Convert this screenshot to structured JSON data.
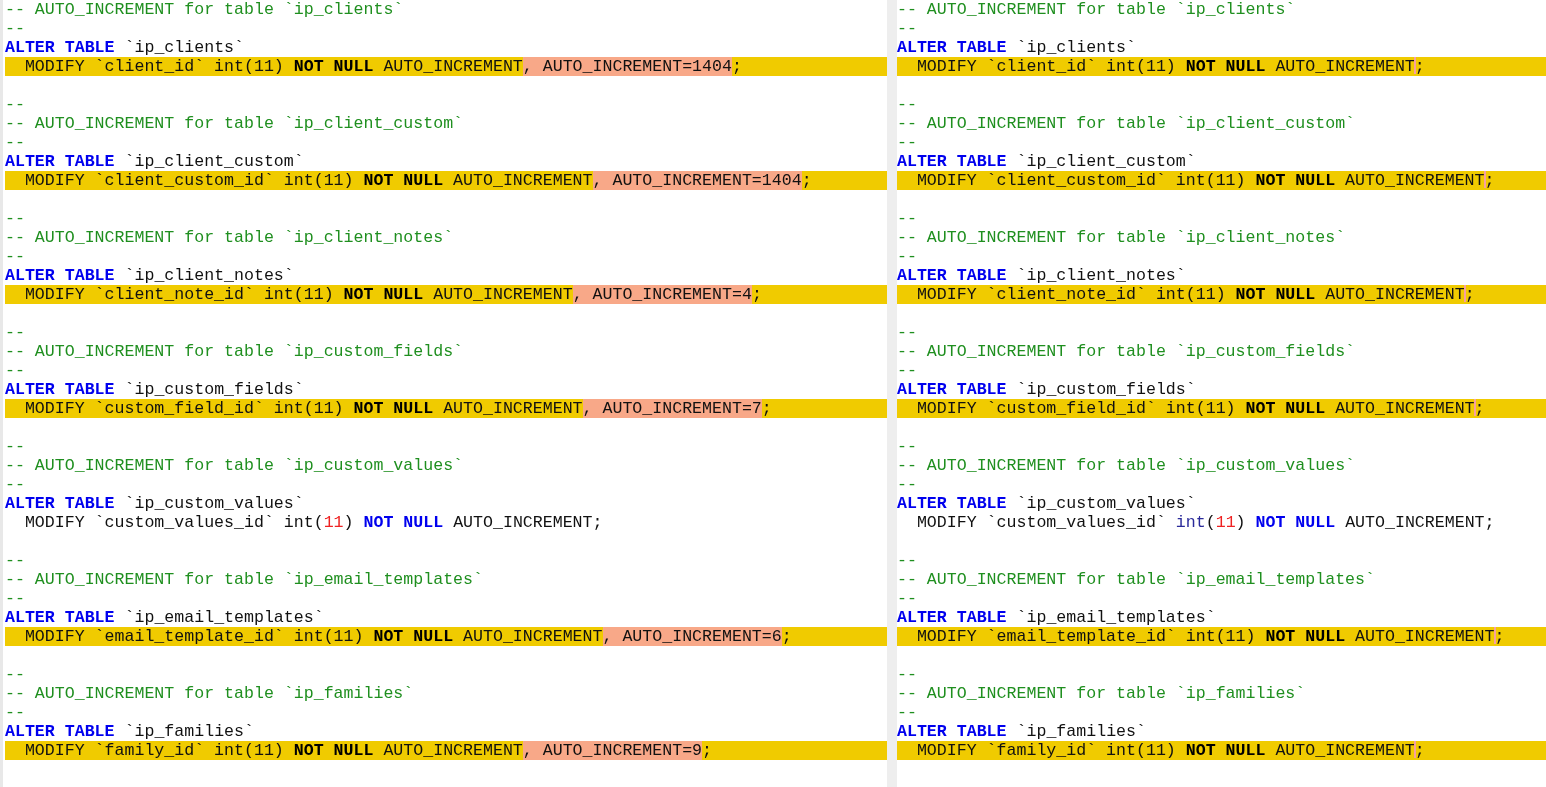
{
  "panes": [
    {
      "lines": [
        {
          "changed": false,
          "segments": [
            {
              "kind": "comment",
              "text": "-- AUTO_INCREMENT for table `ip_clients`"
            }
          ]
        },
        {
          "changed": false,
          "segments": [
            {
              "kind": "comment",
              "text": "--"
            }
          ]
        },
        {
          "changed": false,
          "segments": [
            {
              "kind": "keyword",
              "text": "ALTER TABLE"
            },
            {
              "kind": "text",
              "text": " `ip_clients`"
            }
          ]
        },
        {
          "changed": true,
          "segments": [
            {
              "kind": "text",
              "text": "  MODIFY `client_id` int(11) "
            },
            {
              "kind": "strong",
              "text": "NOT NULL"
            },
            {
              "kind": "text",
              "text": " AUTO_INCREMENT"
            },
            {
              "kind": "text",
              "text": ", AUTO_INCREMENT=1404",
              "removed": true
            },
            {
              "kind": "text",
              "text": ";"
            }
          ]
        },
        {
          "changed": false
        },
        {
          "changed": false,
          "segments": [
            {
              "kind": "comment",
              "text": "--"
            }
          ]
        },
        {
          "changed": false,
          "segments": [
            {
              "kind": "comment",
              "text": "-- AUTO_INCREMENT for table `ip_client_custom`"
            }
          ]
        },
        {
          "changed": false,
          "segments": [
            {
              "kind": "comment",
              "text": "--"
            }
          ]
        },
        {
          "changed": false,
          "segments": [
            {
              "kind": "keyword",
              "text": "ALTER TABLE"
            },
            {
              "kind": "text",
              "text": " `ip_client_custom`"
            }
          ]
        },
        {
          "changed": true,
          "segments": [
            {
              "kind": "text",
              "text": "  MODIFY `client_custom_id` int(11) "
            },
            {
              "kind": "strong",
              "text": "NOT NULL"
            },
            {
              "kind": "text",
              "text": " AUTO_INCREMENT"
            },
            {
              "kind": "text",
              "text": ", AUTO_INCREMENT=1404",
              "removed": true
            },
            {
              "kind": "text",
              "text": ";"
            }
          ]
        },
        {
          "changed": false
        },
        {
          "changed": false,
          "segments": [
            {
              "kind": "comment",
              "text": "--"
            }
          ]
        },
        {
          "changed": false,
          "segments": [
            {
              "kind": "comment",
              "text": "-- AUTO_INCREMENT for table `ip_client_notes`"
            }
          ]
        },
        {
          "changed": false,
          "segments": [
            {
              "kind": "comment",
              "text": "--"
            }
          ]
        },
        {
          "changed": false,
          "segments": [
            {
              "kind": "keyword",
              "text": "ALTER TABLE"
            },
            {
              "kind": "text",
              "text": " `ip_client_notes`"
            }
          ]
        },
        {
          "changed": true,
          "segments": [
            {
              "kind": "text",
              "text": "  MODIFY `client_note_id` int(11) "
            },
            {
              "kind": "strong",
              "text": "NOT NULL"
            },
            {
              "kind": "text",
              "text": " AUTO_INCREMENT"
            },
            {
              "kind": "text",
              "text": ", AUTO_INCREMENT=4",
              "removed": true
            },
            {
              "kind": "text",
              "text": ";"
            }
          ]
        },
        {
          "changed": false
        },
        {
          "changed": false,
          "segments": [
            {
              "kind": "comment",
              "text": "--"
            }
          ]
        },
        {
          "changed": false,
          "segments": [
            {
              "kind": "comment",
              "text": "-- AUTO_INCREMENT for table `ip_custom_fields`"
            }
          ]
        },
        {
          "changed": false,
          "segments": [
            {
              "kind": "comment",
              "text": "--"
            }
          ]
        },
        {
          "changed": false,
          "segments": [
            {
              "kind": "keyword",
              "text": "ALTER TABLE"
            },
            {
              "kind": "text",
              "text": " `ip_custom_fields`"
            }
          ]
        },
        {
          "changed": true,
          "segments": [
            {
              "kind": "text",
              "text": "  MODIFY `custom_field_id` int(11) "
            },
            {
              "kind": "strong",
              "text": "NOT NULL"
            },
            {
              "kind": "text",
              "text": " AUTO_INCREMENT"
            },
            {
              "kind": "text",
              "text": ", AUTO_INCREMENT=7",
              "removed": true
            },
            {
              "kind": "text",
              "text": ";"
            }
          ]
        },
        {
          "changed": false
        },
        {
          "changed": false,
          "segments": [
            {
              "kind": "comment",
              "text": "--"
            }
          ]
        },
        {
          "changed": false,
          "segments": [
            {
              "kind": "comment",
              "text": "-- AUTO_INCREMENT for table `ip_custom_values`"
            }
          ]
        },
        {
          "changed": false,
          "segments": [
            {
              "kind": "comment",
              "text": "--"
            }
          ]
        },
        {
          "changed": false,
          "segments": [
            {
              "kind": "keyword",
              "text": "ALTER TABLE"
            },
            {
              "kind": "text",
              "text": " `ip_custom_values`"
            }
          ]
        },
        {
          "changed": false,
          "segments": [
            {
              "kind": "text",
              "text": "  MODIFY `custom_values_id` int("
            },
            {
              "kind": "number",
              "text": "11"
            },
            {
              "kind": "text",
              "text": ") "
            },
            {
              "kind": "keyword",
              "text": "NOT NULL"
            },
            {
              "kind": "text",
              "text": " AUTO_INCREMENT;"
            }
          ]
        },
        {
          "changed": false
        },
        {
          "changed": false,
          "segments": [
            {
              "kind": "comment",
              "text": "--"
            }
          ]
        },
        {
          "changed": false,
          "segments": [
            {
              "kind": "comment",
              "text": "-- AUTO_INCREMENT for table `ip_email_templates`"
            }
          ]
        },
        {
          "changed": false,
          "segments": [
            {
              "kind": "comment",
              "text": "--"
            }
          ]
        },
        {
          "changed": false,
          "segments": [
            {
              "kind": "keyword",
              "text": "ALTER TABLE"
            },
            {
              "kind": "text",
              "text": " `ip_email_templates`"
            }
          ]
        },
        {
          "changed": true,
          "segments": [
            {
              "kind": "text",
              "text": "  MODIFY `email_template_id` int(11) "
            },
            {
              "kind": "strong",
              "text": "NOT NULL"
            },
            {
              "kind": "text",
              "text": " AUTO_INCREMENT"
            },
            {
              "kind": "text",
              "text": ", AUTO_INCREMENT=6",
              "removed": true
            },
            {
              "kind": "text",
              "text": ";"
            }
          ]
        },
        {
          "changed": false
        },
        {
          "changed": false,
          "segments": [
            {
              "kind": "comment",
              "text": "--"
            }
          ]
        },
        {
          "changed": false,
          "segments": [
            {
              "kind": "comment",
              "text": "-- AUTO_INCREMENT for table `ip_families`"
            }
          ]
        },
        {
          "changed": false,
          "segments": [
            {
              "kind": "comment",
              "text": "--"
            }
          ]
        },
        {
          "changed": false,
          "segments": [
            {
              "kind": "keyword",
              "text": "ALTER TABLE"
            },
            {
              "kind": "text",
              "text": " `ip_families`"
            }
          ]
        },
        {
          "changed": true,
          "segments": [
            {
              "kind": "text",
              "text": "  MODIFY `family_id` int(11) "
            },
            {
              "kind": "strong",
              "text": "NOT NULL"
            },
            {
              "kind": "text",
              "text": " AUTO_INCREMENT"
            },
            {
              "kind": "text",
              "text": ", AUTO_INCREMENT=9",
              "removed": true
            },
            {
              "kind": "text",
              "text": ";"
            }
          ]
        }
      ]
    },
    {
      "lines": [
        {
          "changed": false,
          "segments": [
            {
              "kind": "comment",
              "text": "-- AUTO_INCREMENT for table `ip_clients`"
            }
          ]
        },
        {
          "changed": false,
          "segments": [
            {
              "kind": "comment",
              "text": "--"
            }
          ]
        },
        {
          "changed": false,
          "segments": [
            {
              "kind": "keyword",
              "text": "ALTER TABLE"
            },
            {
              "kind": "text",
              "text": " `ip_clients`"
            }
          ]
        },
        {
          "changed": true,
          "segments": [
            {
              "kind": "text",
              "text": "  MODIFY `client_id` int(11) "
            },
            {
              "kind": "strong",
              "text": "NOT NULL"
            },
            {
              "kind": "text",
              "text": " AUTO_INCREMENT",
              "deleted_after": true
            },
            {
              "kind": "text",
              "text": ";"
            }
          ]
        },
        {
          "changed": false
        },
        {
          "changed": false,
          "segments": [
            {
              "kind": "comment",
              "text": "--"
            }
          ]
        },
        {
          "changed": false,
          "segments": [
            {
              "kind": "comment",
              "text": "-- AUTO_INCREMENT for table `ip_client_custom`"
            }
          ]
        },
        {
          "changed": false,
          "segments": [
            {
              "kind": "comment",
              "text": "--"
            }
          ]
        },
        {
          "changed": false,
          "segments": [
            {
              "kind": "keyword",
              "text": "ALTER TABLE"
            },
            {
              "kind": "text",
              "text": " `ip_client_custom`"
            }
          ]
        },
        {
          "changed": true,
          "segments": [
            {
              "kind": "text",
              "text": "  MODIFY `client_custom_id` int(11) "
            },
            {
              "kind": "strong",
              "text": "NOT NULL"
            },
            {
              "kind": "text",
              "text": " AUTO_INCREMENT",
              "deleted_after": true
            },
            {
              "kind": "text",
              "text": ";"
            }
          ]
        },
        {
          "changed": false
        },
        {
          "changed": false,
          "segments": [
            {
              "kind": "comment",
              "text": "--"
            }
          ]
        },
        {
          "changed": false,
          "segments": [
            {
              "kind": "comment",
              "text": "-- AUTO_INCREMENT for table `ip_client_notes`"
            }
          ]
        },
        {
          "changed": false,
          "segments": [
            {
              "kind": "comment",
              "text": "--"
            }
          ]
        },
        {
          "changed": false,
          "segments": [
            {
              "kind": "keyword",
              "text": "ALTER TABLE"
            },
            {
              "kind": "text",
              "text": " `ip_client_notes`"
            }
          ]
        },
        {
          "changed": true,
          "segments": [
            {
              "kind": "text",
              "text": "  MODIFY `client_note_id` int(11) "
            },
            {
              "kind": "strong",
              "text": "NOT NULL"
            },
            {
              "kind": "text",
              "text": " AUTO_INCREMENT",
              "deleted_after": true
            },
            {
              "kind": "text",
              "text": ";"
            }
          ]
        },
        {
          "changed": false
        },
        {
          "changed": false,
          "segments": [
            {
              "kind": "comment",
              "text": "--"
            }
          ]
        },
        {
          "changed": false,
          "segments": [
            {
              "kind": "comment",
              "text": "-- AUTO_INCREMENT for table `ip_custom_fields`"
            }
          ]
        },
        {
          "changed": false,
          "segments": [
            {
              "kind": "comment",
              "text": "--"
            }
          ]
        },
        {
          "changed": false,
          "segments": [
            {
              "kind": "keyword",
              "text": "ALTER TABLE"
            },
            {
              "kind": "text",
              "text": " `ip_custom_fields`"
            }
          ]
        },
        {
          "changed": true,
          "segments": [
            {
              "kind": "text",
              "text": "  MODIFY `custom_field_id` int(11) "
            },
            {
              "kind": "strong",
              "text": "NOT NULL"
            },
            {
              "kind": "text",
              "text": " AUTO_INCREMENT",
              "deleted_after": true
            },
            {
              "kind": "text",
              "text": ";"
            }
          ]
        },
        {
          "changed": false
        },
        {
          "changed": false,
          "segments": [
            {
              "kind": "comment",
              "text": "--"
            }
          ]
        },
        {
          "changed": false,
          "segments": [
            {
              "kind": "comment",
              "text": "-- AUTO_INCREMENT for table `ip_custom_values`"
            }
          ]
        },
        {
          "changed": false,
          "segments": [
            {
              "kind": "comment",
              "text": "--"
            }
          ]
        },
        {
          "changed": false,
          "segments": [
            {
              "kind": "keyword",
              "text": "ALTER TABLE"
            },
            {
              "kind": "text",
              "text": " `ip_custom_values`"
            }
          ]
        },
        {
          "changed": false,
          "segments": [
            {
              "kind": "text",
              "text": "  MODIFY `custom_values_id` "
            },
            {
              "kind": "type",
              "text": "int"
            },
            {
              "kind": "text",
              "text": "("
            },
            {
              "kind": "number",
              "text": "11"
            },
            {
              "kind": "text",
              "text": ") "
            },
            {
              "kind": "keyword",
              "text": "NOT NULL"
            },
            {
              "kind": "text",
              "text": " AUTO_INCREMENT;"
            }
          ]
        },
        {
          "changed": false
        },
        {
          "changed": false,
          "segments": [
            {
              "kind": "comment",
              "text": "--"
            }
          ]
        },
        {
          "changed": false,
          "segments": [
            {
              "kind": "comment",
              "text": "-- AUTO_INCREMENT for table `ip_email_templates`"
            }
          ]
        },
        {
          "changed": false,
          "segments": [
            {
              "kind": "comment",
              "text": "--"
            }
          ]
        },
        {
          "changed": false,
          "segments": [
            {
              "kind": "keyword",
              "text": "ALTER TABLE"
            },
            {
              "kind": "text",
              "text": " `ip_email_templates`"
            }
          ]
        },
        {
          "changed": true,
          "segments": [
            {
              "kind": "text",
              "text": "  MODIFY `email_template_id` int(11) "
            },
            {
              "kind": "strong",
              "text": "NOT NULL"
            },
            {
              "kind": "text",
              "text": " AUTO_INCREMENT",
              "deleted_after": true
            },
            {
              "kind": "text",
              "text": ";"
            }
          ]
        },
        {
          "changed": false
        },
        {
          "changed": false,
          "segments": [
            {
              "kind": "comment",
              "text": "--"
            }
          ]
        },
        {
          "changed": false,
          "segments": [
            {
              "kind": "comment",
              "text": "-- AUTO_INCREMENT for table `ip_families`"
            }
          ]
        },
        {
          "changed": false,
          "segments": [
            {
              "kind": "comment",
              "text": "--"
            }
          ]
        },
        {
          "changed": false,
          "segments": [
            {
              "kind": "keyword",
              "text": "ALTER TABLE"
            },
            {
              "kind": "text",
              "text": " `ip_families`"
            }
          ]
        },
        {
          "changed": true,
          "segments": [
            {
              "kind": "text",
              "text": "  MODIFY `family_id` int(11) "
            },
            {
              "kind": "strong",
              "text": "NOT NULL"
            },
            {
              "kind": "text",
              "text": " AUTO_INCREMENT",
              "deleted_after": true
            },
            {
              "kind": "text",
              "text": ";"
            }
          ]
        }
      ]
    }
  ]
}
